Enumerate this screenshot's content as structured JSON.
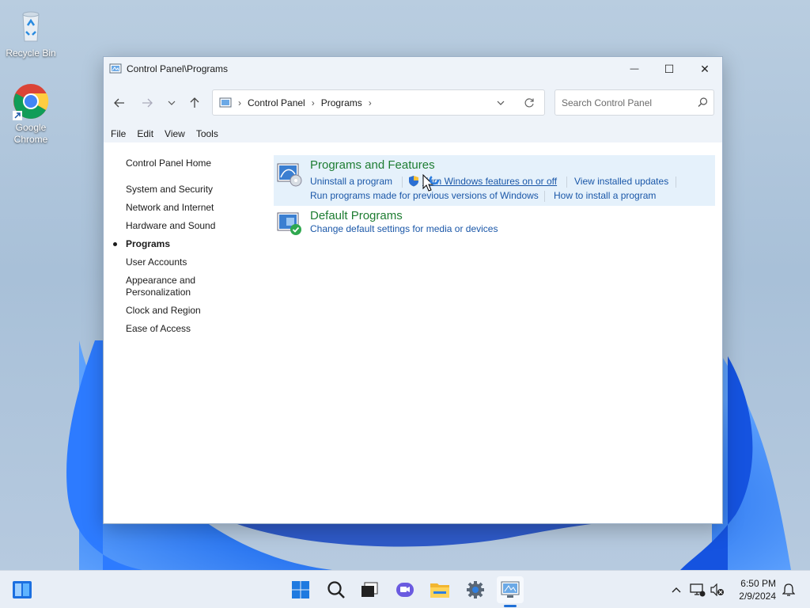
{
  "desktop": {
    "icons": [
      {
        "label": "Recycle Bin"
      },
      {
        "label": "Google Chrome"
      }
    ]
  },
  "window": {
    "title": "Control Panel\\Programs",
    "controls": {
      "minimize": "—",
      "maximize": "☐",
      "close": "✕"
    },
    "address": {
      "crumbs": [
        "Control Panel",
        "Programs"
      ]
    },
    "search": {
      "placeholder": "Search Control Panel"
    },
    "menu": [
      "File",
      "Edit",
      "View",
      "Tools"
    ]
  },
  "left_nav": {
    "home": "Control Panel Home",
    "items": [
      {
        "label": "System and Security",
        "active": false
      },
      {
        "label": "Network and Internet",
        "active": false
      },
      {
        "label": "Hardware and Sound",
        "active": false
      },
      {
        "label": "Programs",
        "active": true
      },
      {
        "label": "User Accounts",
        "active": false
      },
      {
        "label": "Appearance and Personalization",
        "active": false
      },
      {
        "label": "Clock and Region",
        "active": false
      },
      {
        "label": "Ease of Access",
        "active": false
      }
    ]
  },
  "categories": [
    {
      "title": "Programs and Features",
      "links": [
        "Uninstall a program",
        "Turn Windows features on or off",
        "View installed updates",
        "Run programs made for previous versions of Windows",
        "How to install a program"
      ]
    },
    {
      "title": "Default Programs",
      "links": [
        "Change default settings for media or devices"
      ]
    }
  ],
  "taskbar": {
    "clock": {
      "time": "6:50 PM",
      "date": "2/9/2024"
    }
  },
  "colors": {
    "link": "#1a57a8",
    "category_title": "#1e7d32",
    "highlight": "#e5f1fb"
  }
}
